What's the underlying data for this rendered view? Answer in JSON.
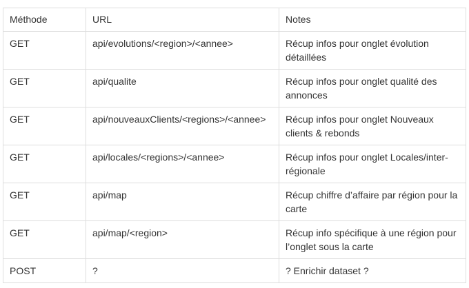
{
  "table": {
    "headers": [
      "Méthode",
      "URL",
      "Notes"
    ],
    "rows": [
      {
        "method": "GET",
        "url": "api/evolutions/<region>/<annee>",
        "notes": "Récup infos pour onglet évolution détaillées"
      },
      {
        "method": "GET",
        "url": "api/qualite",
        "notes": "Récup infos pour onglet qualité des annonces"
      },
      {
        "method": "GET",
        "url": "api/nouveauxClients/<regions>/<annee>",
        "notes": "Récup infos pour onglet Nouveaux clients & rebonds"
      },
      {
        "method": "GET",
        "url": "api/locales/<regions>/<annee>",
        "notes": "Récup infos pour onglet Locales/inter-régionale"
      },
      {
        "method": "GET",
        "url": "api/map",
        "notes": "Récup chiffre d’affaire par région pour la carte"
      },
      {
        "method": "GET",
        "url": "api/map/<region>",
        "notes": "Récup info spécifique à une région pour l’onglet sous la carte"
      },
      {
        "method": "POST",
        "url": "?",
        "notes": "? Enrichir dataset ?"
      }
    ]
  }
}
